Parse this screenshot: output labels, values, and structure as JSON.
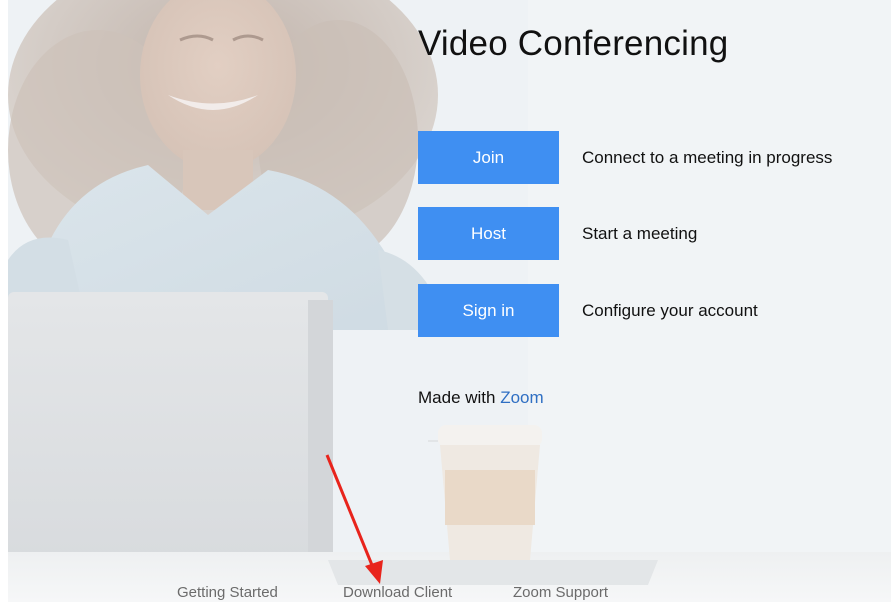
{
  "main": {
    "title": "Video Conferencing",
    "actions": [
      {
        "label": "Join",
        "description": "Connect to a meeting in progress"
      },
      {
        "label": "Host",
        "description": "Start a meeting"
      },
      {
        "label": "Sign in",
        "description": "Configure your account"
      }
    ],
    "made_with_prefix": "Made with",
    "made_with_link": "Zoom"
  },
  "footer": {
    "links": [
      "Getting Started",
      "Download Client",
      "Zoom Support"
    ]
  },
  "colors": {
    "button_bg": "#3f8ff2",
    "link": "#2f6fc3",
    "annotation_arrow": "#e8241c"
  }
}
